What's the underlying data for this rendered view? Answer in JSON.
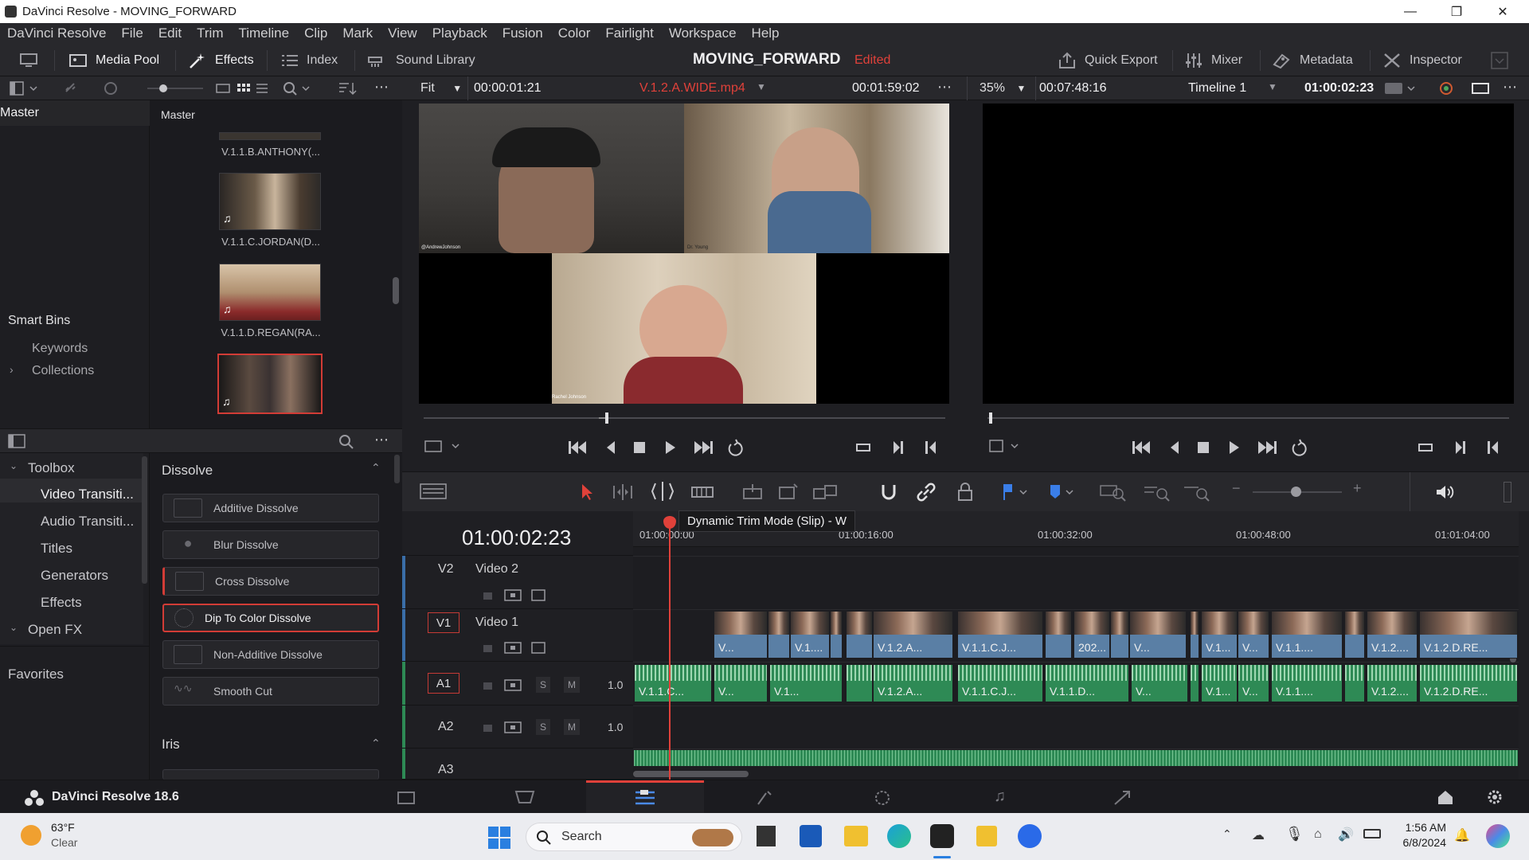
{
  "window": {
    "title": "DaVinci Resolve - MOVING_FORWARD"
  },
  "menu": [
    "DaVinci Resolve",
    "File",
    "Edit",
    "Trim",
    "Timeline",
    "Clip",
    "Mark",
    "View",
    "Playback",
    "Fusion",
    "Color",
    "Fairlight",
    "Workspace",
    "Help"
  ],
  "toolbar": {
    "media_pool": "Media Pool",
    "effects": "Effects",
    "index": "Index",
    "sound_library": "Sound Library",
    "project": "MOVING_FORWARD",
    "status": "Edited",
    "quick_export": "Quick Export",
    "mixer": "Mixer",
    "metadata": "Metadata",
    "inspector": "Inspector"
  },
  "source_viewer": {
    "fit": "Fit",
    "timecode_in": "00:00:01:21",
    "clip_name": "V.1.2.A.WIDE.mp4",
    "duration": "00:01:59:02"
  },
  "timeline_viewer": {
    "zoom": "35%",
    "timecode": "00:07:48:16",
    "timeline_name": "Timeline 1",
    "current_tc": "01:00:02:23"
  },
  "media_pool": {
    "bin_title": "Master",
    "clip_header": "Master",
    "smart_bins": "Smart Bins",
    "keywords": "Keywords",
    "collections": "Collections",
    "clips": [
      {
        "name": "V.1.1.B.ANTHONY(..."
      },
      {
        "name": "V.1.1.C.JORDAN(D..."
      },
      {
        "name": "V.1.1.D.REGAN(RA..."
      },
      {
        "name": ""
      }
    ]
  },
  "toolbox": {
    "items": [
      "Toolbox",
      "Video Transiti...",
      "Audio Transiti...",
      "Titles",
      "Generators",
      "Effects",
      "Open FX",
      "Favorites"
    ]
  },
  "effects": {
    "dissolve_header": "Dissolve",
    "iris_header": "Iris",
    "dissolves": [
      "Additive Dissolve",
      "Blur Dissolve",
      "Cross Dissolve",
      "Dip To Color Dissolve",
      "Non-Additive Dissolve",
      "Smooth Cut"
    ]
  },
  "timeline": {
    "current_tc": "01:00:02:23",
    "tooltip": "Dynamic Trim Mode (Slip) - W",
    "ruler": [
      "01:00:00:00",
      "01:00:16:00",
      "01:00:32:00",
      "01:00:48:00",
      "01:01:04:00"
    ],
    "tracks": {
      "v2": {
        "id": "V2",
        "name": "Video 2"
      },
      "v1": {
        "id": "V1",
        "name": "Video 1"
      },
      "a1": {
        "id": "A1",
        "level": "1.0"
      },
      "a2": {
        "id": "A2",
        "level": "1.0"
      },
      "a3": {
        "id": "A3"
      }
    },
    "video_clips": [
      "V...",
      "V.1....",
      "V.1.2.A...",
      "V.1.1.C.J...",
      "202...",
      "V...",
      "V.1...",
      "V...",
      "V.1.1....",
      "V.1.2....",
      "V.1.2.D.RE..."
    ],
    "audio_clips": [
      "V.1.1.C...",
      "V...",
      "V.1...",
      "V.1.2.A...",
      "V.1.1.C.J...",
      "V.1.1.D...",
      "V...",
      "V.1...",
      "V...",
      "V.1.1....",
      "V.1.2....",
      "V.1.2.D.RE..."
    ],
    "s_label": "S",
    "m_label": "M"
  },
  "video_labels": {
    "top_left": "@AndrewJohnson",
    "top_right": "Dr. Young",
    "bottom": "Rachel Johnson"
  },
  "app": {
    "version": "DaVinci Resolve 18.6"
  },
  "taskbar": {
    "temp": "63°F",
    "weather": "Clear",
    "search": "Search",
    "time": "1:56 AM",
    "date": "6/8/2024"
  }
}
